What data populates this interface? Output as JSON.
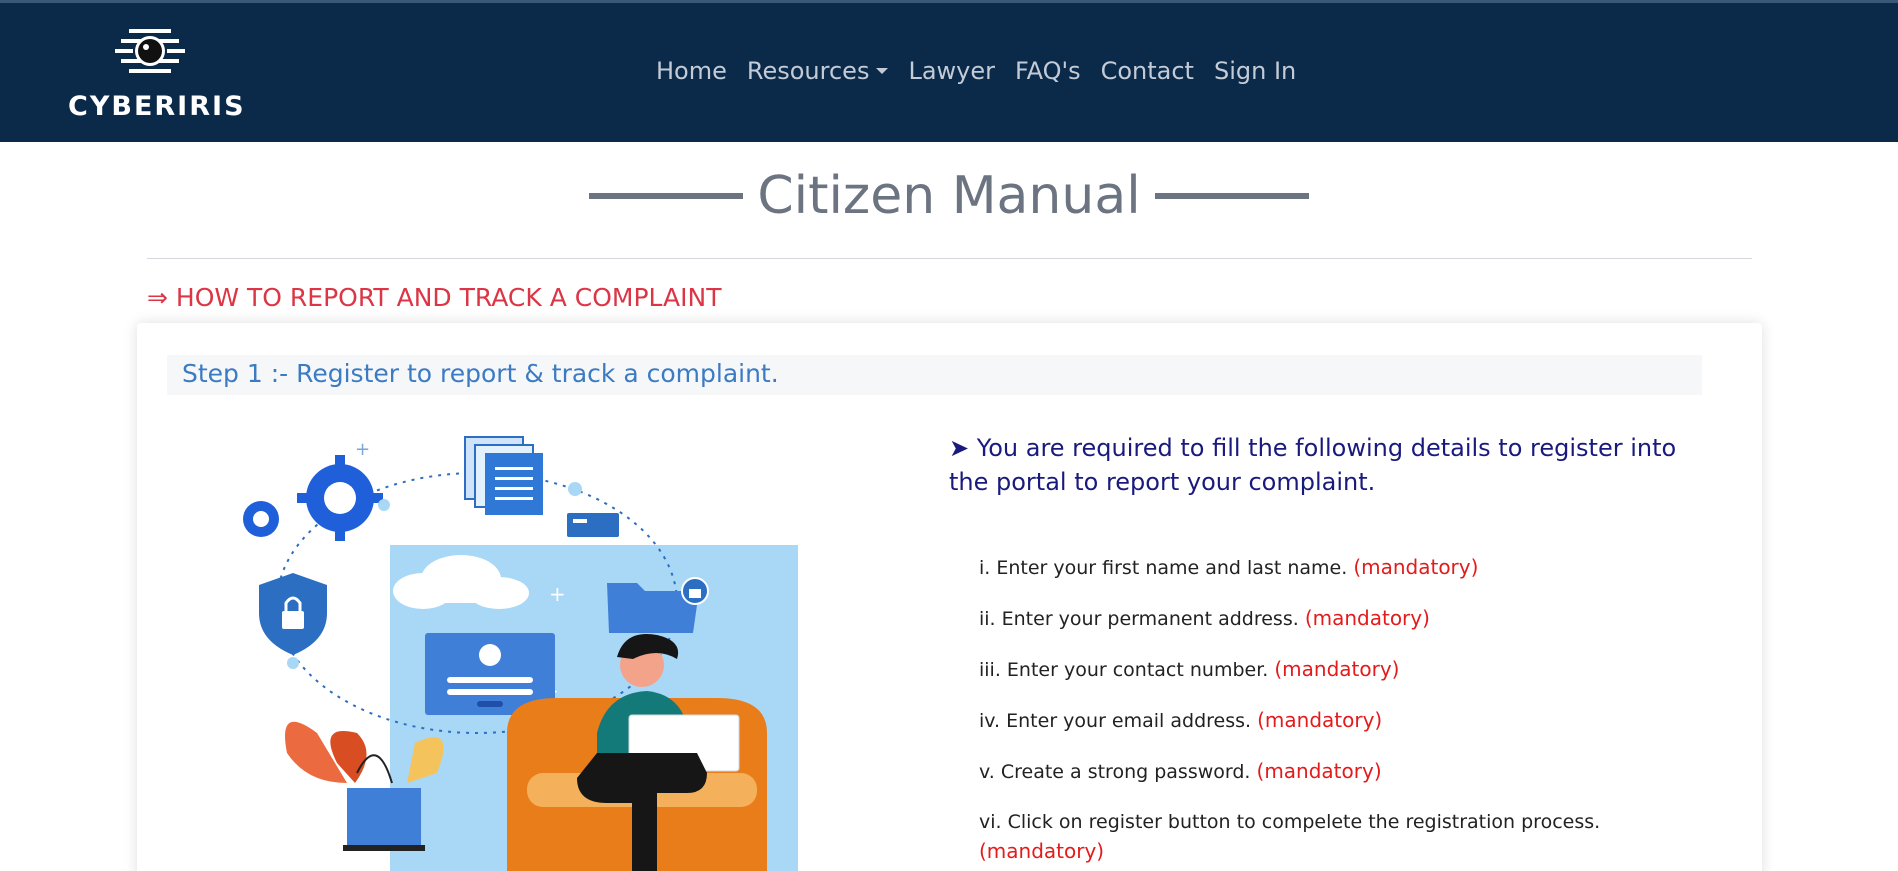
{
  "brand": {
    "name": "CYBERIRIS"
  },
  "nav": {
    "items": [
      {
        "label": "Home"
      },
      {
        "label": "Resources"
      },
      {
        "label": "Lawyer"
      },
      {
        "label": "FAQ's"
      },
      {
        "label": "Contact"
      },
      {
        "label": "Sign In"
      }
    ]
  },
  "page": {
    "title": "Citizen Manual",
    "section_heading": "⇒ HOW TO REPORT AND TRACK A COMPLAINT"
  },
  "card": {
    "step_title": "Step 1 :- Register to report & track a complaint.",
    "intro": "➤ You are required to fill the following details to register into the portal to report your complaint.",
    "steps": [
      {
        "text": "i. Enter your first name and last name.",
        "tag": "(mandatory)"
      },
      {
        "text": "ii. Enter your permanent address.",
        "tag": "(mandatory)"
      },
      {
        "text": "iii. Enter your contact number.",
        "tag": "(mandatory)"
      },
      {
        "text": "iv. Enter your email address.",
        "tag": "(mandatory)"
      },
      {
        "text": "v. Create a strong password.",
        "tag": "(mandatory)"
      },
      {
        "text": "vi. Click on register button to compelete the registration process.",
        "tag": "(mandatory)"
      }
    ]
  },
  "colors": {
    "navbar": "#0b2a4a",
    "accent_red": "#dc3545",
    "step_blue": "#3b7bc3",
    "intro_navy": "#1a1a7e",
    "mandatory_red": "#e31b1b"
  },
  "icons": [
    "logo-eye-icon",
    "dropdown-caret-icon",
    "registration-illustration"
  ]
}
